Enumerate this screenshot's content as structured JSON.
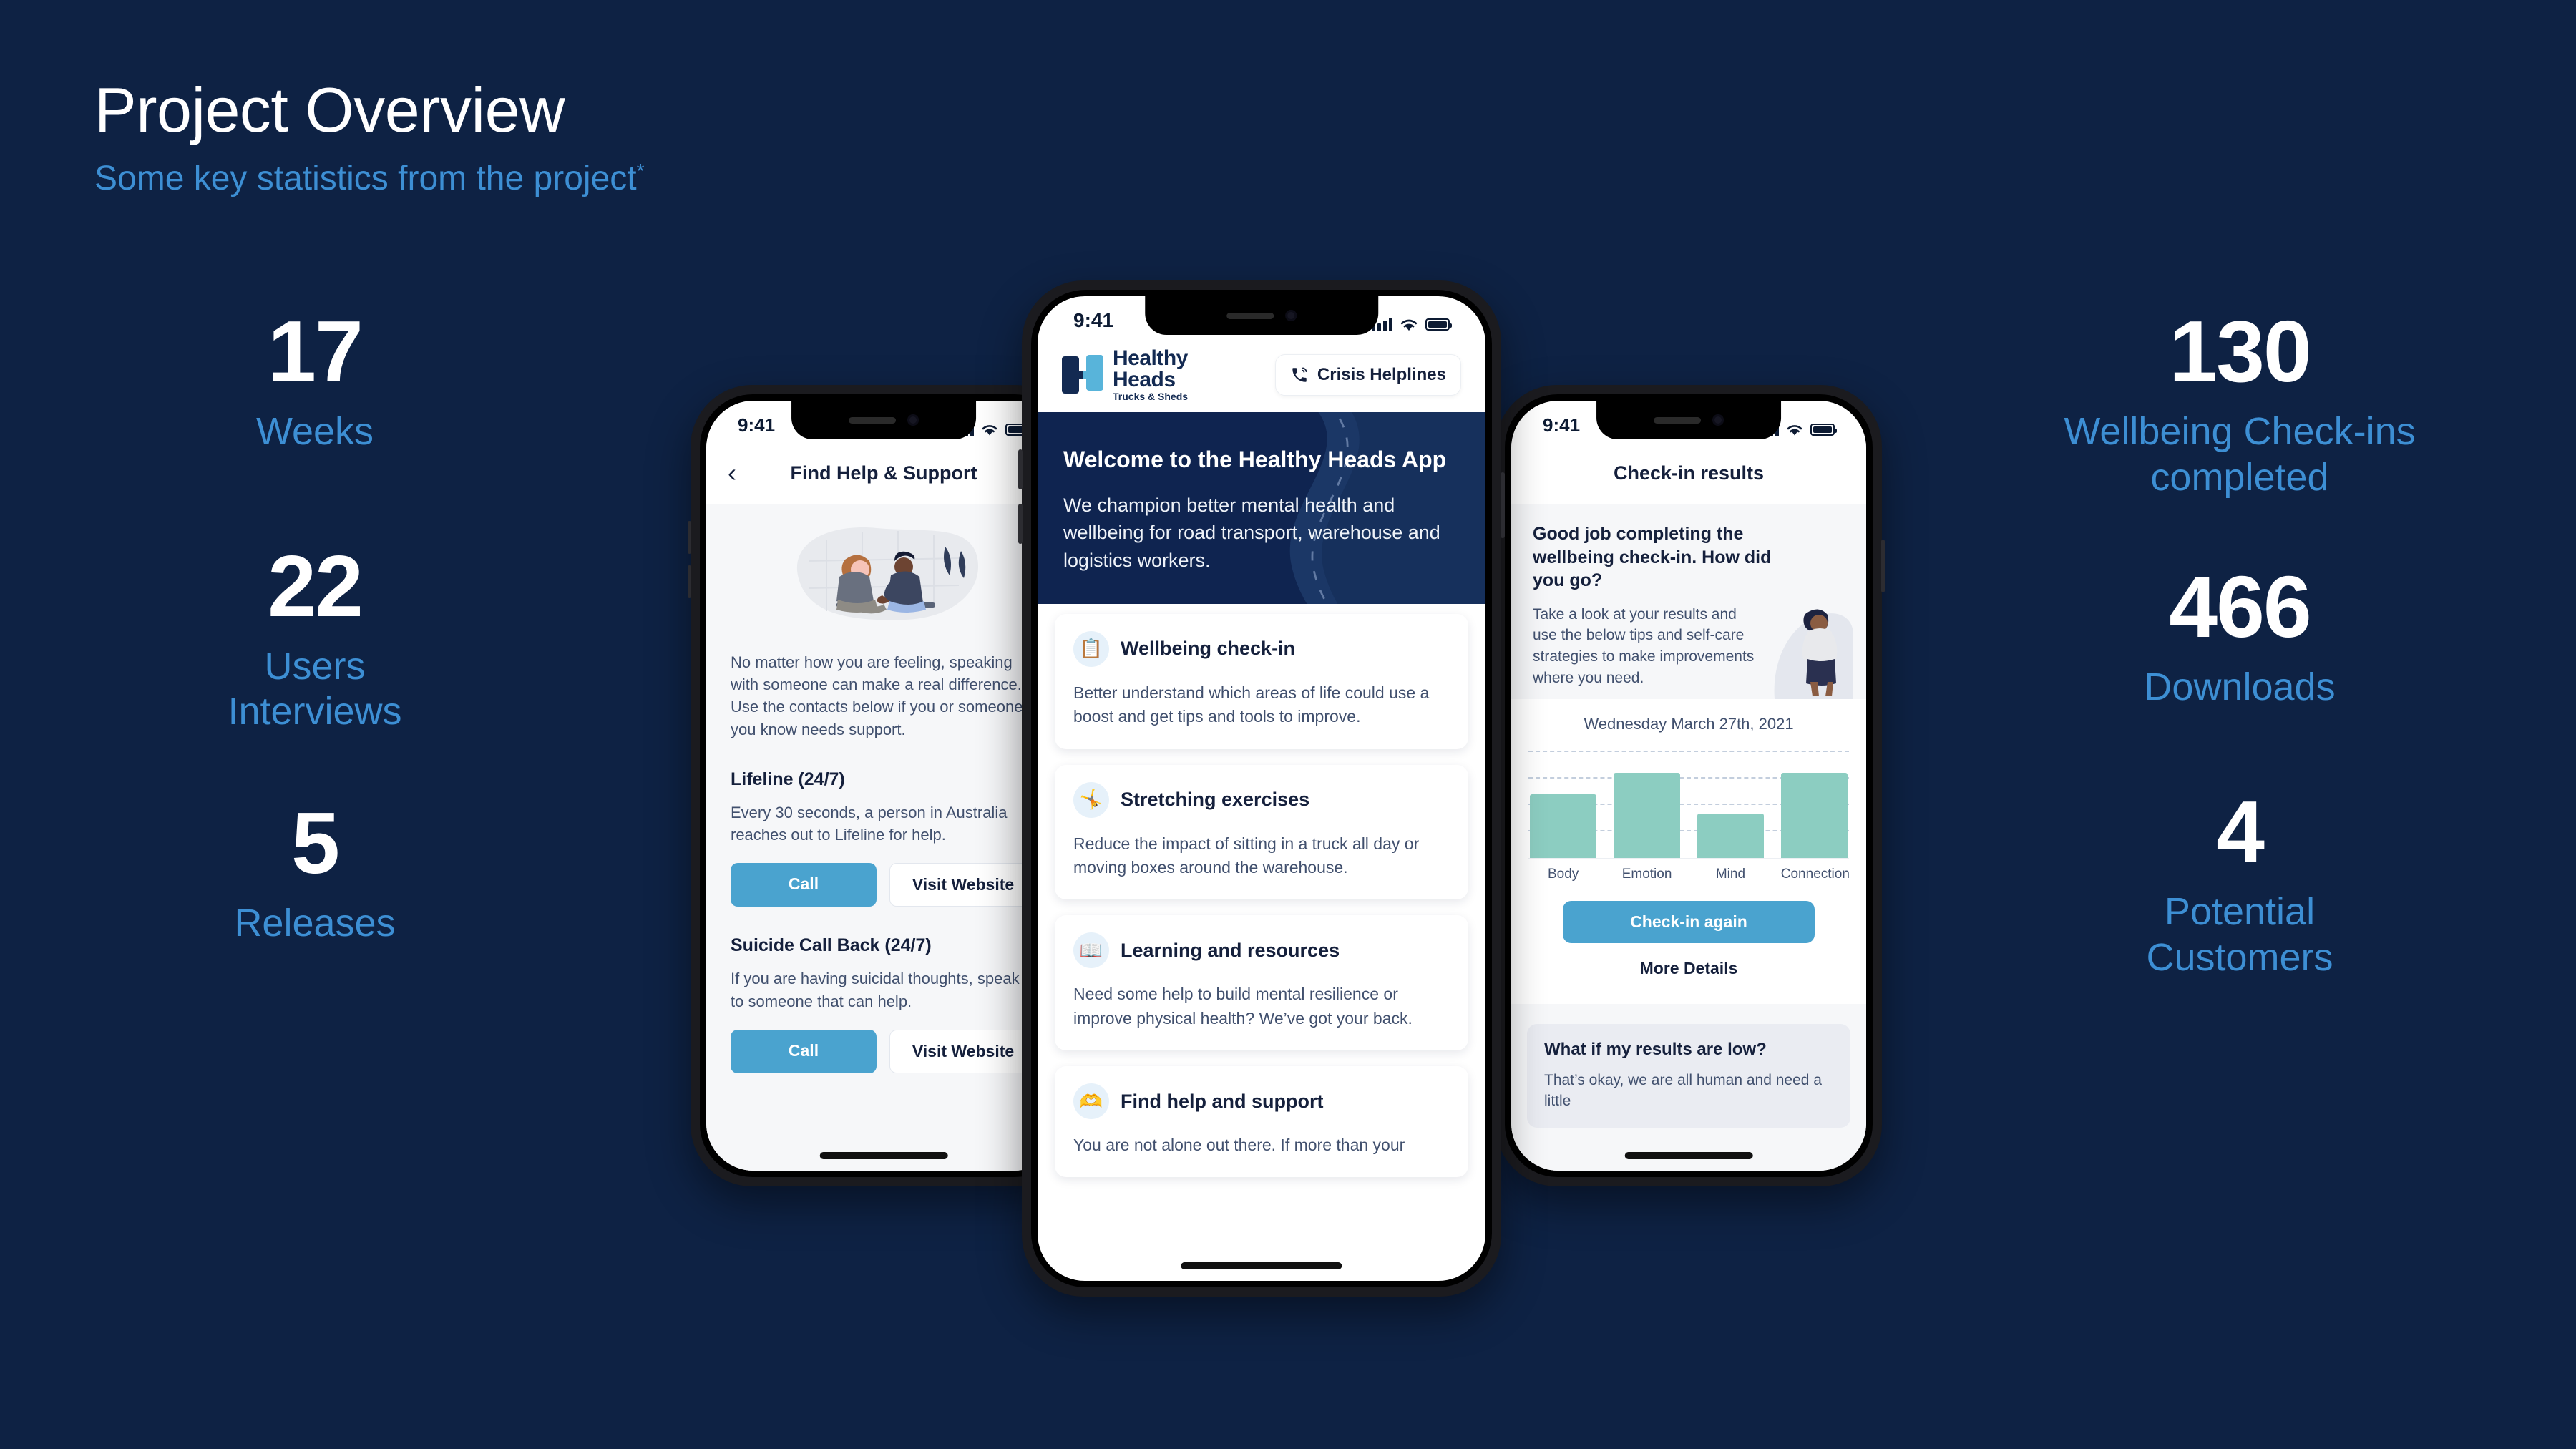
{
  "header": {
    "title": "Project Overview",
    "subtitle": "Some key statistics from the project",
    "subtitle_marker": "*"
  },
  "colors": {
    "background": "#0e2244",
    "accent_blue": "#3d8fd4",
    "value_white": "#ffffff",
    "app_primary": "#4aa3cf",
    "app_navy": "#0f2450",
    "chart_bar": "#8ccdc1"
  },
  "stats_left": [
    {
      "value": "17",
      "label": "Weeks"
    },
    {
      "value": "22",
      "label": "Users\nInterviews"
    },
    {
      "value": "5",
      "label": "Releases"
    }
  ],
  "stats_right": [
    {
      "value": "130",
      "label": "Wellbeing Check-ins\ncompleted"
    },
    {
      "value": "466",
      "label": "Downloads"
    },
    {
      "value": "4",
      "label": "Potential\nCustomers"
    }
  ],
  "phone_left": {
    "status_time": "9:41",
    "back_icon": "chevron-left-icon",
    "nav_title": "Find Help & Support",
    "intro": "No matter how you are feeling, speaking with someone can make a real difference. Use the contacts below if you or someone you know needs support.",
    "sections": [
      {
        "title": "Lifeline (24/7)",
        "body": "Every 30 seconds, a person in Australia reaches out to Lifeline for help.",
        "primary_button": "Call",
        "secondary_button": "Visit Website"
      },
      {
        "title": "Suicide Call Back (24/7)",
        "body": "If you are having suicidal thoughts, speak to someone that can help.",
        "primary_button": "Call",
        "secondary_button": "Visit Website"
      }
    ]
  },
  "phone_center": {
    "status_time": "9:41",
    "logo": {
      "line1": "Healthy",
      "line2": "Heads",
      "tagline": "Trucks & Sheds"
    },
    "helpline_button": {
      "icon": "phone-call-icon",
      "label": "Crisis Helplines"
    },
    "hero": {
      "title": "Welcome to the Healthy Heads App",
      "body": "We champion better mental health and wellbeing for road transport, warehouse and logistics workers."
    },
    "cards": [
      {
        "icon": "clipboard-checkin-icon",
        "glyph": "📋",
        "title": "Wellbeing check-in",
        "body": "Better understand which areas of life could use a boost and get tips and tools to improve."
      },
      {
        "icon": "stretching-person-icon",
        "glyph": "🤸",
        "title": "Stretching exercises",
        "body": "Reduce the impact of sitting in a truck all day or moving boxes around the warehouse."
      },
      {
        "icon": "open-book-icon",
        "glyph": "📖",
        "title": "Learning and resources",
        "body": "Need some help to build mental resilience or improve physical health? We’ve got your back."
      },
      {
        "icon": "helping-hands-icon",
        "glyph": "🫶",
        "title": "Find help and support",
        "body": "You are not alone out there. If more than your"
      }
    ]
  },
  "phone_right": {
    "status_time": "9:41",
    "nav_title": "Check-in results",
    "hero_title": "Good job completing the wellbeing check-in. How did you go?",
    "hero_body": "Take a look at your results and use the below tips and self-care strategies to make improvements where you need.",
    "checkin_button": "Check-in again",
    "more_details": "More Details",
    "low_card": {
      "title": "What if my results are low?",
      "body": "That’s okay, we are all human and need a little"
    }
  },
  "chart_data": {
    "type": "bar",
    "title": "Wednesday March 27th, 2021",
    "categories": [
      "Body",
      "Emotion",
      "Mind",
      "Connection"
    ],
    "values": [
      60,
      80,
      42,
      80
    ],
    "ylim": [
      0,
      100
    ],
    "xlabel": "",
    "ylabel": "",
    "grid": true,
    "gridlines": [
      25,
      50,
      75,
      100
    ],
    "legend": "none",
    "bar_color": "#8ccdc1"
  }
}
